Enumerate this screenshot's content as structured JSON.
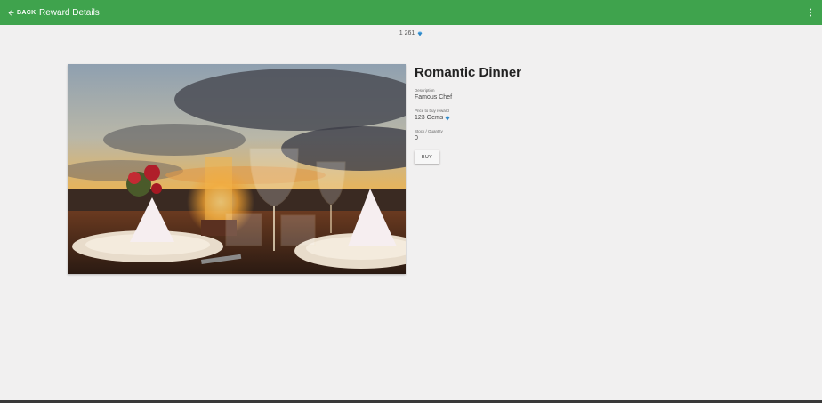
{
  "header": {
    "back_label": "BACK",
    "title": "Reward Details",
    "accent_color": "#3fa34d"
  },
  "balance": {
    "value": "1 261",
    "icon": "gem-icon"
  },
  "reward": {
    "name": "Romantic Dinner",
    "image": "romantic-dinner-photo",
    "fields": {
      "description_label": "Description",
      "description_value": "Famous Chef",
      "price_label": "Price to buy reward",
      "price_value": "123 Gems",
      "stock_label": "Stock / Quantity",
      "stock_value": "0"
    },
    "buy_label": "BUY"
  }
}
